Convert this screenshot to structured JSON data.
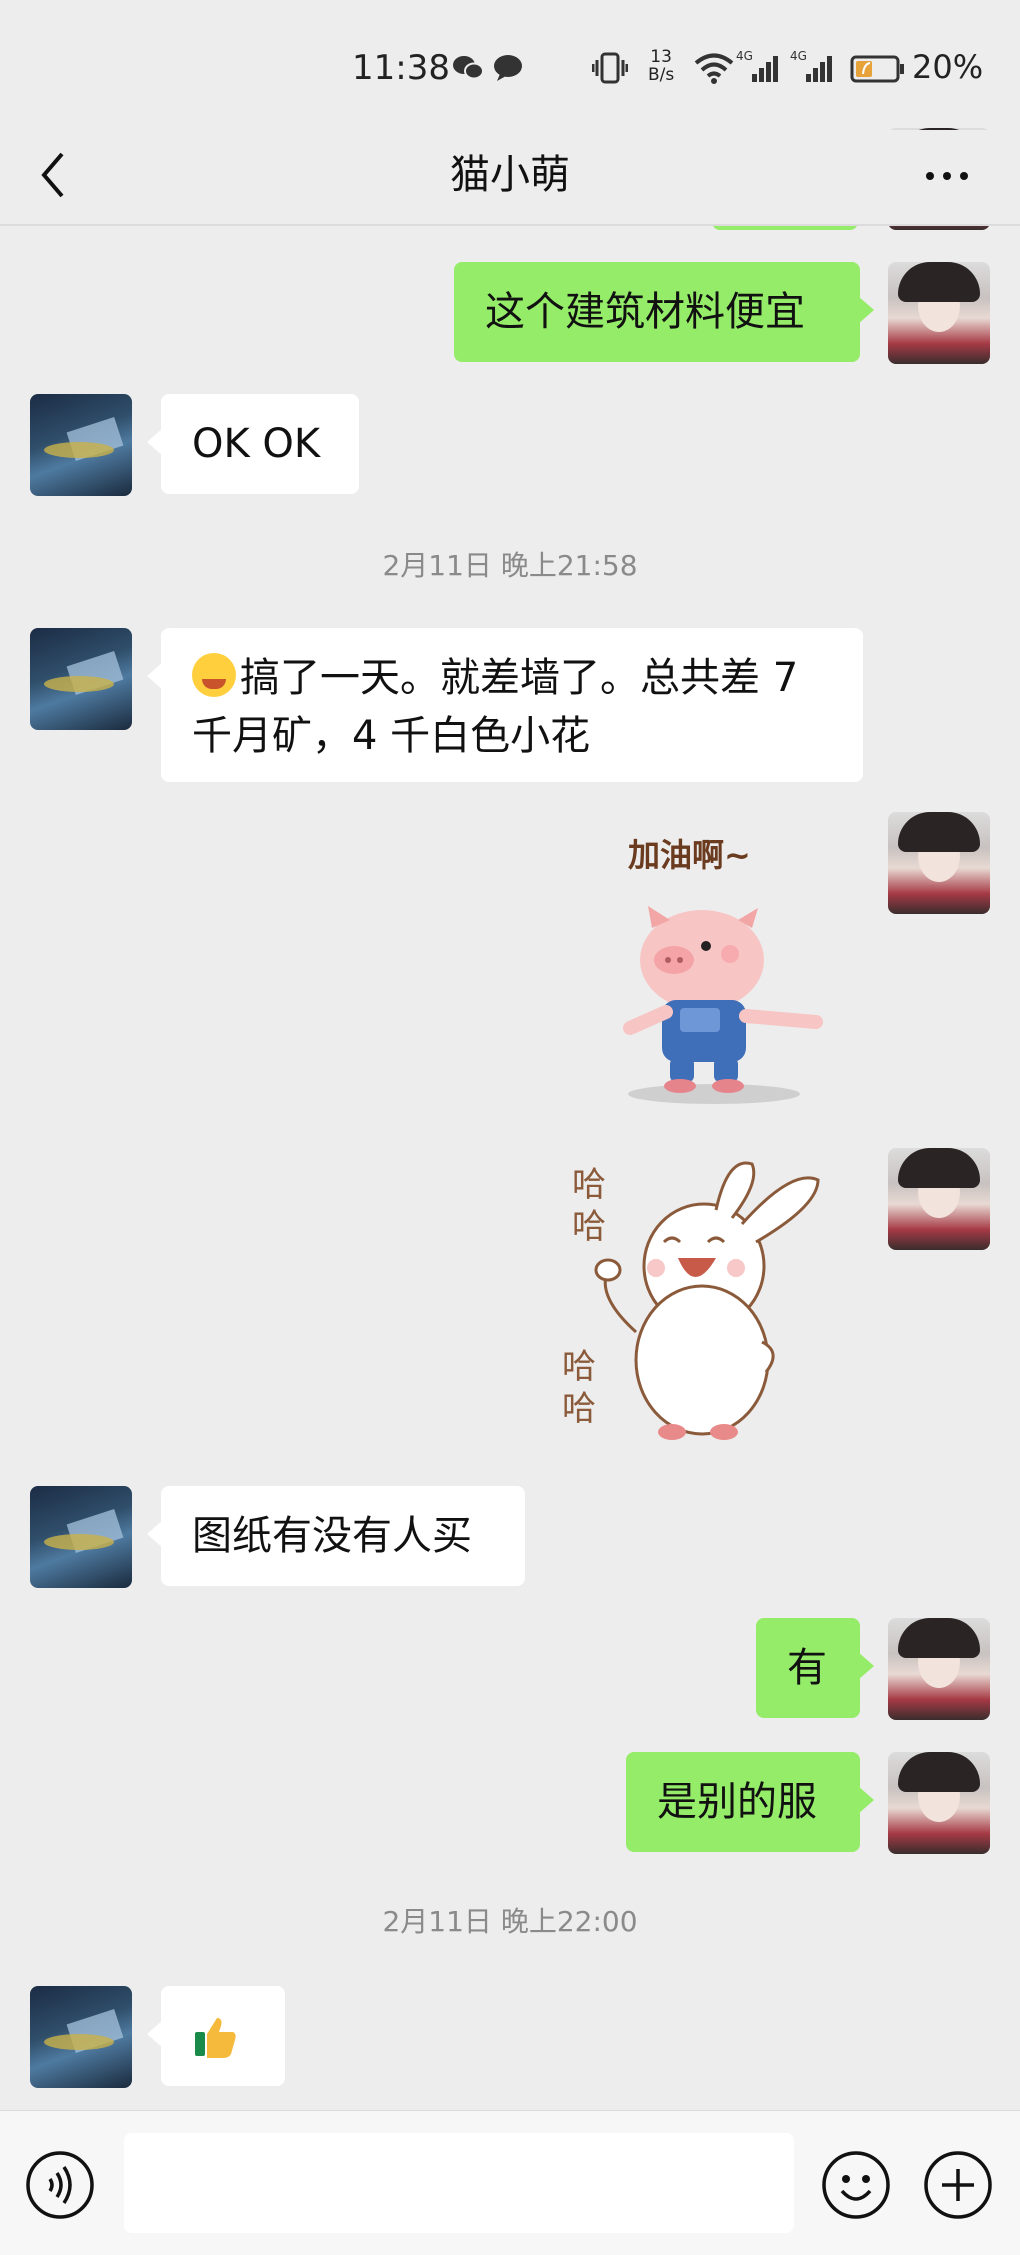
{
  "status_bar": {
    "time": "11:38",
    "net_speed_value": "13",
    "net_speed_unit": "B/s",
    "signal_1": "4G",
    "signal_2": "4G",
    "battery": "20%",
    "icons": [
      "wechat-icon",
      "chat-icon",
      "vibrate-icon",
      "wifi-icon",
      "signal-icon",
      "battery-icon"
    ]
  },
  "header": {
    "title": "猫小萌"
  },
  "messages": [
    {
      "side": "right",
      "type": "text",
      "text": "这个建筑材料便宜"
    },
    {
      "side": "left",
      "type": "text",
      "text": "OK OK"
    },
    {
      "type": "timestamp",
      "text": "2月11日 晚上21:58"
    },
    {
      "side": "left",
      "type": "text",
      "emoji": "grimace-laugh-emoji",
      "line1": "搞了一天。就差墙了。总共差 7",
      "line2": "千月矿，4 千白色小花"
    },
    {
      "side": "right",
      "type": "sticker",
      "sticker": "pig-cheer-sticker",
      "caption": "加油啊~"
    },
    {
      "side": "right",
      "type": "sticker",
      "sticker": "bunny-laugh-sticker",
      "caption_top": "哈哈",
      "caption_bottom": "哈哈"
    },
    {
      "side": "left",
      "type": "text",
      "text": "图纸有没有人买"
    },
    {
      "side": "right",
      "type": "text",
      "text": "有"
    },
    {
      "side": "right",
      "type": "text",
      "text": "是别的服"
    },
    {
      "type": "timestamp",
      "text": "2月11日 晚上22:00"
    },
    {
      "side": "left",
      "type": "emoji",
      "emoji": "thumbs-up-emoji"
    }
  ],
  "input": {
    "placeholder": ""
  },
  "colors": {
    "background": "#ededed",
    "my_bubble": "#95ec69",
    "their_bubble": "#ffffff"
  }
}
